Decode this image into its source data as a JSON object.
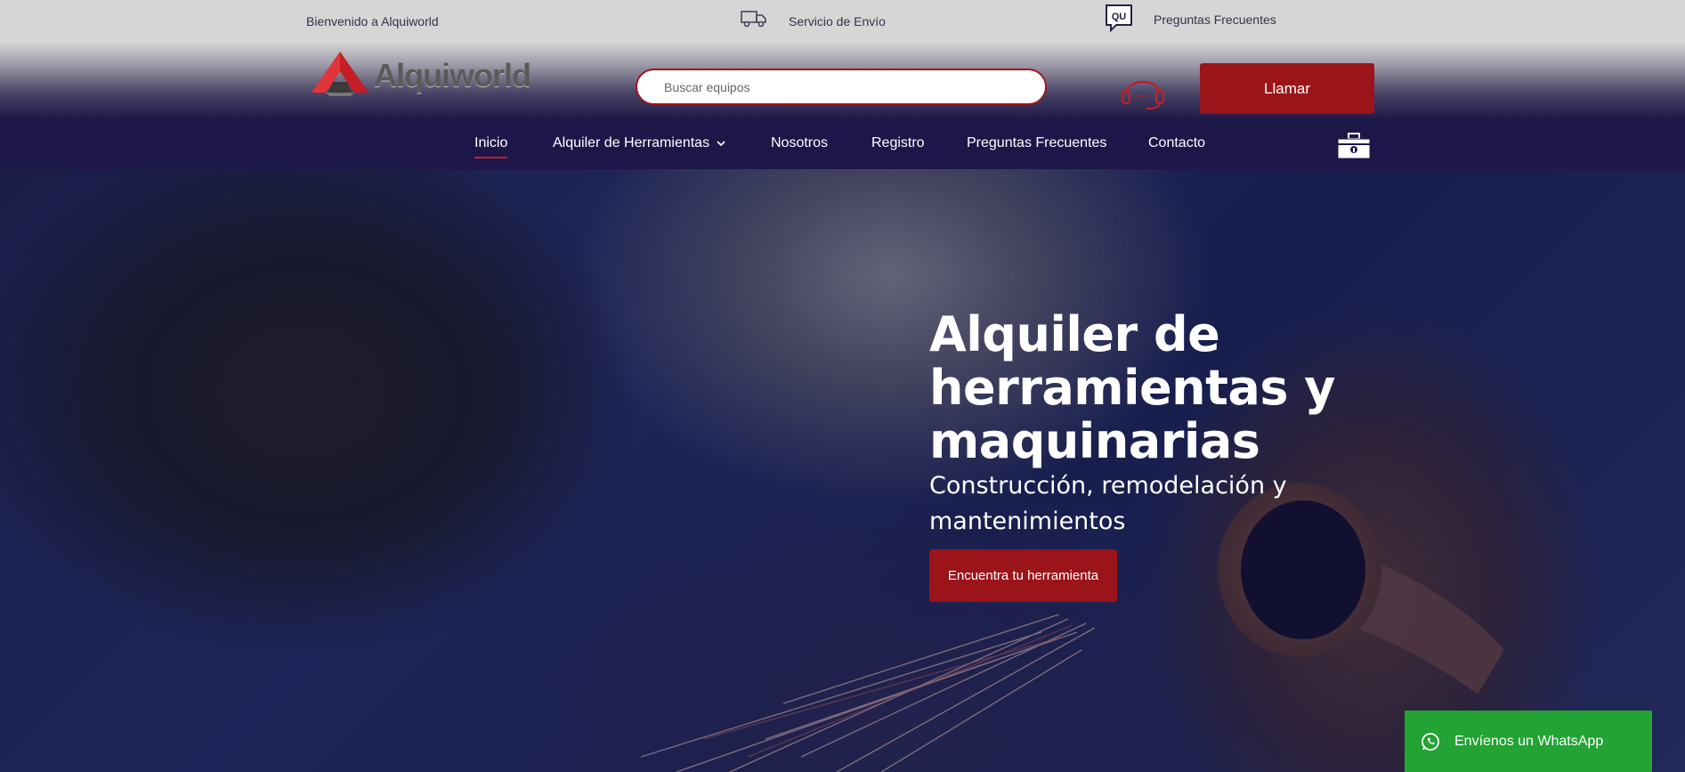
{
  "topbar": {
    "welcome": "Bienvenido a Alquiworld",
    "shipping": "Servicio de Envío",
    "faq_badge": "QU",
    "faq": "Preguntas Frecuentes"
  },
  "header": {
    "logo_text": "Alquiworld",
    "search_placeholder": "Buscar equipos",
    "call_label": "Llamar"
  },
  "nav": {
    "items": [
      {
        "label": "Inicio"
      },
      {
        "label": "Alquiler de Herramientas"
      },
      {
        "label": "Nosotros"
      },
      {
        "label": "Registro"
      },
      {
        "label": "Preguntas Frecuentes"
      },
      {
        "label": "Contacto"
      }
    ]
  },
  "hero": {
    "title": "Alquiler de herramientas y maquinarias",
    "subtitle": "Construcción, remodelación y mantenimientos",
    "cta": "Encuentra tu herramienta"
  },
  "whatsapp": {
    "label": "Envíenos un WhatsApp"
  },
  "colors": {
    "accent_red": "#9b1419",
    "nav_bg": "#1d1749",
    "whatsapp_green": "#22a333"
  },
  "icons": [
    "truck-icon",
    "chat-bubble-icon",
    "headset-icon",
    "chevron-down-icon",
    "toolbox-icon",
    "whatsapp-icon"
  ]
}
